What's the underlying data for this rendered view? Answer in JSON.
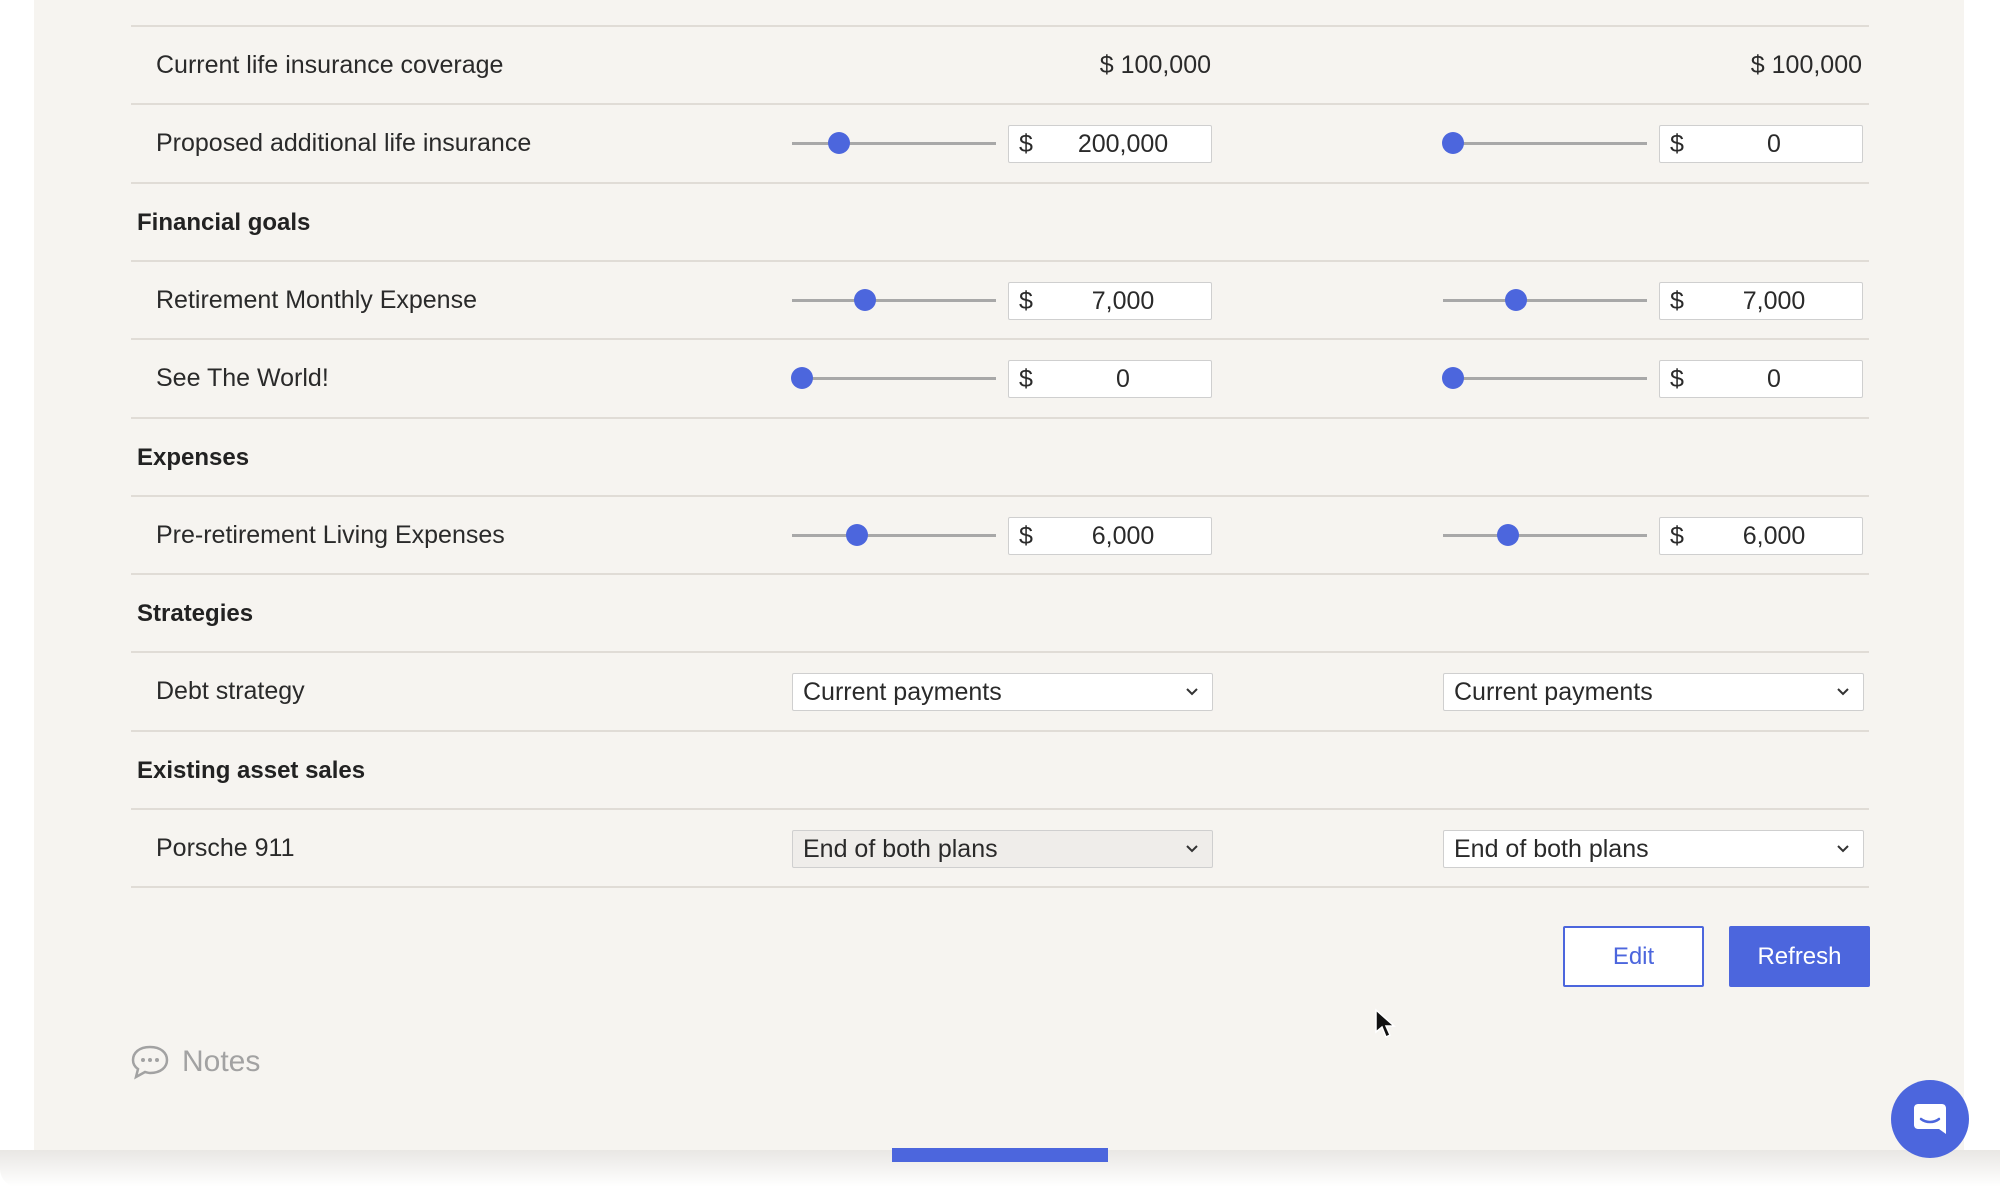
{
  "coverage": {
    "label": "Current life insurance coverage",
    "plan_a_value": "$ 100,000",
    "plan_b_value": "$ 100,000"
  },
  "rows": {
    "additional_life": {
      "label": "Proposed additional life insurance",
      "plan_a": {
        "currency": "$",
        "value": "200,000",
        "slider_level": 0.23
      },
      "plan_b": {
        "currency": "$",
        "value": "0",
        "slider_level": 0.05
      }
    },
    "retirement_expense": {
      "label": "Retirement Monthly Expense",
      "plan_a": {
        "currency": "$",
        "value": "7,000",
        "slider_level": 0.36
      },
      "plan_b": {
        "currency": "$",
        "value": "7,000",
        "slider_level": 0.36
      }
    },
    "see_world": {
      "label": "See The World!",
      "plan_a": {
        "currency": "$",
        "value": "0",
        "slider_level": 0.05
      },
      "plan_b": {
        "currency": "$",
        "value": "0",
        "slider_level": 0.05
      }
    },
    "pre_retirement": {
      "label": "Pre-retirement Living Expenses",
      "plan_a": {
        "currency": "$",
        "value": "6,000",
        "slider_level": 0.32
      },
      "plan_b": {
        "currency": "$",
        "value": "6,000",
        "slider_level": 0.32
      }
    },
    "debt_strategy": {
      "label": "Debt strategy",
      "plan_a": "Current payments",
      "plan_b": "Current payments"
    },
    "porsche": {
      "label": "Porsche 911",
      "plan_a": "End of both plans",
      "plan_b": "End of both plans"
    }
  },
  "sections": {
    "financial_goals": "Financial goals",
    "expenses": "Expenses",
    "strategies": "Strategies",
    "asset_sales": "Existing asset sales"
  },
  "buttons": {
    "edit": "Edit",
    "refresh": "Refresh"
  },
  "notes": {
    "label": "Notes",
    "icon": "speech-bubble-icon"
  },
  "chat": {
    "icon": "chat-icon"
  },
  "colors": {
    "accent": "#4c66dd",
    "panel_bg": "#f6f4f0",
    "divider": "#e0dcd6"
  }
}
